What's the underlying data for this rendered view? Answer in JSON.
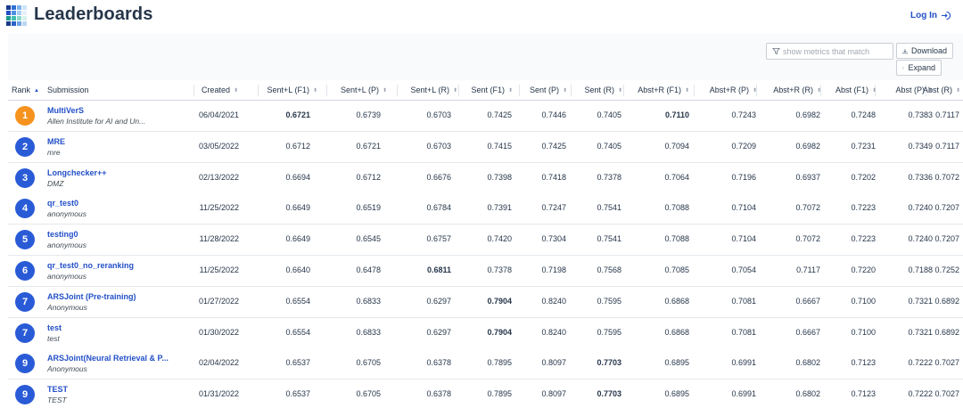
{
  "header": {
    "title": "Leaderboards",
    "login_label": "Log In",
    "logo_colors": [
      "#1b3a8c",
      "#2f6fd6",
      "#7fb3ec",
      "#cfe3f8",
      "#2350c8",
      "#4d8fe0",
      "#a9cdf3",
      "#e6f0fb",
      "#1f9b8e",
      "#3fbfb0",
      "#8fd9cf",
      "#d6f1ed",
      "#173a86",
      "#2b63c8",
      "#6fa3e4",
      "#bcd6f5"
    ]
  },
  "toolbar": {
    "filter_placeholder": "show metrics that match",
    "download_label": "Download",
    "expand_label": "Expand"
  },
  "table": {
    "rank_header": "Rank",
    "submission_header": "Submission",
    "columns": [
      "Created",
      "Sent+L (F1)",
      "Sent+L (P)",
      "Sent+L (R)",
      "Sent (F1)",
      "Sent (P)",
      "Sent (R)",
      "Abst+R (F1)",
      "Abst+R (P)",
      "Abst+R (R)",
      "Abst (F1)",
      "Abst (P)",
      "Abst (R)"
    ],
    "rows": [
      {
        "rank": "1",
        "badge_color": "#f5931e",
        "name": "MultiVerS",
        "org": "Allen Institute for AI and Un...",
        "values": [
          "06/04/2021",
          "0.6721",
          "0.6739",
          "0.6703",
          "0.7425",
          "0.7446",
          "0.7405",
          "0.7110",
          "0.7243",
          "0.6982",
          "0.7248",
          "0.7383",
          "0.7117"
        ],
        "bold": [
          1,
          7
        ]
      },
      {
        "rank": "2",
        "badge_color": "#2a5bd7",
        "name": "MRE",
        "org": "mre",
        "values": [
          "03/05/2022",
          "0.6712",
          "0.6721",
          "0.6703",
          "0.7415",
          "0.7425",
          "0.7405",
          "0.7094",
          "0.7209",
          "0.6982",
          "0.7231",
          "0.7349",
          "0.7117"
        ],
        "bold": []
      },
      {
        "rank": "3",
        "badge_color": "#2a5bd7",
        "name": "Longchecker++",
        "org": "DMZ",
        "values": [
          "02/13/2022",
          "0.6694",
          "0.6712",
          "0.6676",
          "0.7398",
          "0.7418",
          "0.7378",
          "0.7064",
          "0.7196",
          "0.6937",
          "0.7202",
          "0.7336",
          "0.7072"
        ],
        "bold": []
      },
      {
        "rank": "4",
        "badge_color": "#2a5bd7",
        "name": "qr_test0",
        "org": "anonymous",
        "values": [
          "11/25/2022",
          "0.6649",
          "0.6519",
          "0.6784",
          "0.7391",
          "0.7247",
          "0.7541",
          "0.7088",
          "0.7104",
          "0.7072",
          "0.7223",
          "0.7240",
          "0.7207"
        ],
        "bold": []
      },
      {
        "rank": "5",
        "badge_color": "#2a5bd7",
        "name": "testing0",
        "org": "anonymous",
        "values": [
          "11/28/2022",
          "0.6649",
          "0.6545",
          "0.6757",
          "0.7420",
          "0.7304",
          "0.7541",
          "0.7088",
          "0.7104",
          "0.7072",
          "0.7223",
          "0.7240",
          "0.7207"
        ],
        "bold": []
      },
      {
        "rank": "6",
        "badge_color": "#2a5bd7",
        "name": "qr_test0_no_reranking",
        "org": "anonymous",
        "values": [
          "11/25/2022",
          "0.6640",
          "0.6478",
          "0.6811",
          "0.7378",
          "0.7198",
          "0.7568",
          "0.7085",
          "0.7054",
          "0.7117",
          "0.7220",
          "0.7188",
          "0.7252"
        ],
        "bold": [
          3
        ]
      },
      {
        "rank": "7",
        "badge_color": "#2a5bd7",
        "name": "ARSJoint (Pre-training)",
        "org": "Anonymous",
        "values": [
          "01/27/2022",
          "0.6554",
          "0.6833",
          "0.6297",
          "0.7904",
          "0.8240",
          "0.7595",
          "0.6868",
          "0.7081",
          "0.6667",
          "0.7100",
          "0.7321",
          "0.6892"
        ],
        "bold": [
          4
        ]
      },
      {
        "rank": "7",
        "badge_color": "#2a5bd7",
        "name": "test",
        "org": "test",
        "values": [
          "01/30/2022",
          "0.6554",
          "0.6833",
          "0.6297",
          "0.7904",
          "0.8240",
          "0.7595",
          "0.6868",
          "0.7081",
          "0.6667",
          "0.7100",
          "0.7321",
          "0.6892"
        ],
        "bold": [
          4
        ]
      },
      {
        "rank": "9",
        "badge_color": "#2a5bd7",
        "name": "ARSJoint(Neural Retrieval & P...",
        "org": "Anonymous",
        "values": [
          "02/04/2022",
          "0.6537",
          "0.6705",
          "0.6378",
          "0.7895",
          "0.8097",
          "0.7703",
          "0.6895",
          "0.6991",
          "0.6802",
          "0.7123",
          "0.7222",
          "0.7027"
        ],
        "bold": [
          6
        ]
      },
      {
        "rank": "9",
        "badge_color": "#2a5bd7",
        "name": "TEST",
        "org": "TEST",
        "values": [
          "01/31/2022",
          "0.6537",
          "0.6705",
          "0.6378",
          "0.7895",
          "0.8097",
          "0.7703",
          "0.6895",
          "0.6991",
          "0.6802",
          "0.7123",
          "0.7222",
          "0.7027"
        ],
        "bold": [
          6
        ]
      }
    ]
  }
}
